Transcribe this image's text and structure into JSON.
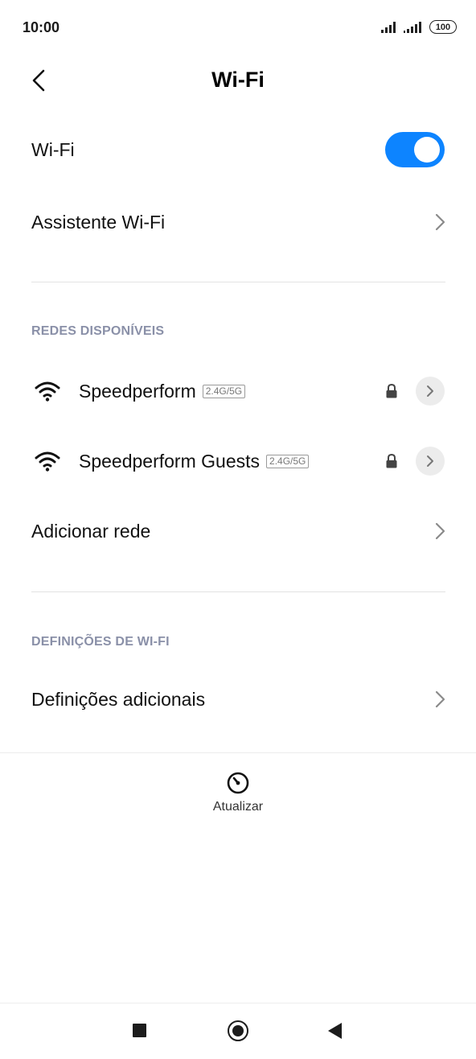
{
  "status_bar": {
    "time": "10:00",
    "battery": "100"
  },
  "header": {
    "title": "Wi-Fi",
    "back_icon": "chevron-left-icon"
  },
  "wifi_toggle": {
    "label": "Wi-Fi",
    "enabled": true,
    "accent_color": "#0d84ff"
  },
  "assistant": {
    "label": "Assistente Wi-Fi"
  },
  "available_networks": {
    "section_title": "REDES DISPONÍVEIS",
    "networks": [
      {
        "name": "Speedperform",
        "band": "2.4G/5G",
        "secured": true
      },
      {
        "name": "Speedperform Guests",
        "band": "2.4G/5G",
        "secured": true
      }
    ],
    "add_network_label": "Adicionar rede"
  },
  "wifi_settings": {
    "section_title": "DEFINIÇÕES DE WI-FI",
    "additional_label": "Definições adicionais"
  },
  "refresh": {
    "label": "Atualizar",
    "icon": "refresh-icon"
  },
  "nav": {
    "recent_icon": "square-icon",
    "home_icon": "circle-icon",
    "back_icon": "triangle-back-icon"
  }
}
